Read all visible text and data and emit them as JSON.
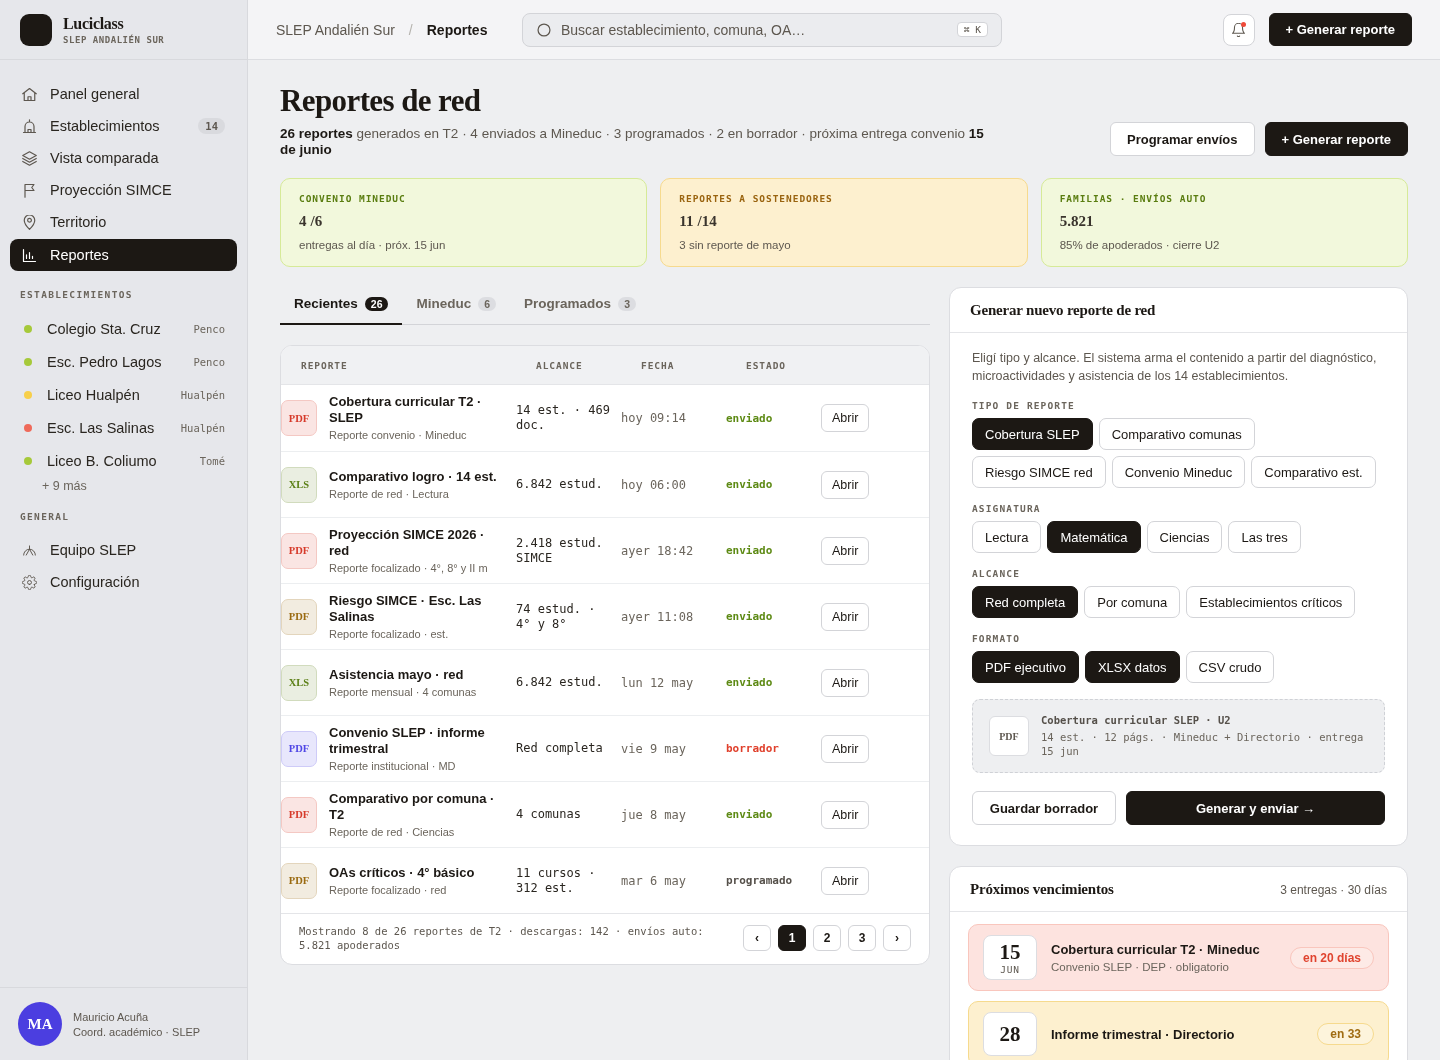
{
  "sidebar": {
    "brand": {
      "name": "Luciclass",
      "subtitle": "SLEP ANDALIÉN SUR"
    },
    "nav": [
      {
        "label": "Panel general",
        "selected": false
      },
      {
        "label": "Establecimientos",
        "badge": "14",
        "selected": false
      },
      {
        "label": "Vista comparada",
        "selected": false
      },
      {
        "label": "Proyección SIMCE",
        "selected": false
      },
      {
        "label": "Territorio",
        "selected": false
      },
      {
        "label": "Reportes",
        "selected": true
      }
    ],
    "schools_heading": "ESTABLECIMIENTOS",
    "schools": [
      {
        "name": "Colegio Sta. Cruz",
        "commune": "Penco",
        "color": "#a6c93a"
      },
      {
        "name": "Esc. Pedro Lagos",
        "commune": "Penco",
        "color": "#a6c93a"
      },
      {
        "name": "Liceo Hualpén",
        "commune": "Hualpén",
        "color": "#f7cf4a"
      },
      {
        "name": "Esc. Las Salinas",
        "commune": "Hualpén",
        "color": "#ef6a5a"
      },
      {
        "name": "Liceo B. Coliumo",
        "commune": "Tomé",
        "color": "#a6c93a"
      }
    ],
    "schools_more": "+ 9 más",
    "general_heading": "GENERAL",
    "general": [
      {
        "label": "Equipo SLEP",
        "selected": false
      },
      {
        "label": "Configuración",
        "selected": false
      }
    ],
    "user": {
      "initials": "MA",
      "name": "Mauricio Acuña",
      "role": "Coord. académico · SLEP"
    }
  },
  "topbar": {
    "breadcrumb": {
      "items": [
        "SLEP Andalién Sur",
        "Reportes"
      ],
      "separator": "/"
    },
    "search": {
      "placeholder": "Buscar establecimiento, comuna, OA…",
      "shortcut": "⌘ K"
    },
    "notifications": {
      "unread": true
    },
    "primary_button": "+ Generar reporte"
  },
  "header": {
    "title": "Reportes de red",
    "summary": "**26 reportes** generados en T2 · 4 enviados a Mineduc · 3 programados · 2 en borrador · próxima entrega convenio **15 de junio**",
    "actions": [
      {
        "label": "Programar envíos",
        "kind": "secondary"
      },
      {
        "label": "+ Generar reporte",
        "kind": "primary"
      }
    ]
  },
  "kpis": [
    {
      "label": "CONVENIO MINEDUC",
      "value": "4",
      "total": "/6",
      "note": "entregas al día · próx. 15 jun",
      "kind": "ok"
    },
    {
      "label": "REPORTES A SOSTENEDORES",
      "value": "11",
      "total": "/14",
      "note": "3 sin reporte de mayo",
      "kind": "warning"
    },
    {
      "label": "FAMILIAS · ENVÍOS AUTO",
      "value": "5.821",
      "note": "85% de apoderados · cierre U2",
      "kind": "ok"
    }
  ],
  "tabs": [
    {
      "label": "Recientes",
      "count": "26",
      "selected": true
    },
    {
      "label": "Mineduc",
      "count": "6",
      "selected": false
    },
    {
      "label": "Programados",
      "count": "3",
      "selected": false
    }
  ],
  "table": {
    "columns": [
      "REPORTE",
      "ALCANCE",
      "FECHA",
      "ESTADO"
    ],
    "rows": [
      {
        "file": {
          "format": "PDF",
          "color": "#d63a2a"
        },
        "title": "Cobertura curricular T2 · SLEP",
        "subtitle": "Reporte convenio · Mineduc",
        "scope": "14 est. · 469 doc.",
        "date": "hoy 09:14",
        "status": {
          "label": "enviado",
          "color": "#5d8a14"
        },
        "action": "Abrir"
      },
      {
        "file": {
          "format": "XLS",
          "color": "#5b7f15"
        },
        "title": "Comparativo logro · 14 est.",
        "subtitle": "Reporte de red · Lectura",
        "scope": "6.842 estud.",
        "date": "hoy 06:00",
        "status": {
          "label": "enviado",
          "color": "#5d8a14"
        },
        "action": "Abrir"
      },
      {
        "file": {
          "format": "PDF",
          "color": "#d63a2a"
        },
        "title": "Proyección SIMCE 2026 · red",
        "subtitle": "Reporte focalizado · 4°, 8° y II m",
        "scope": "2.418 estud. SIMCE",
        "date": "ayer 18:42",
        "status": {
          "label": "enviado",
          "color": "#5d8a14"
        },
        "action": "Abrir"
      },
      {
        "file": {
          "format": "PDF",
          "color": "#9a6a10"
        },
        "title": "Riesgo SIMCE · Esc. Las Salinas",
        "subtitle": "Reporte focalizado · est.",
        "scope": "74 estud. · 4° y 8°",
        "date": "ayer 11:08",
        "status": {
          "label": "enviado",
          "color": "#5d8a14"
        },
        "action": "Abrir"
      },
      {
        "file": {
          "format": "XLS",
          "color": "#5b7f15"
        },
        "title": "Asistencia mayo · red",
        "subtitle": "Reporte mensual · 4 comunas",
        "scope": "6.842 estud.",
        "date": "lun 12 may",
        "status": {
          "label": "enviado",
          "color": "#5d8a14"
        },
        "action": "Abrir"
      },
      {
        "file": {
          "format": "PDF",
          "color": "#4f46e5"
        },
        "title": "Convenio SLEP · informe trimestral",
        "subtitle": "Reporte institucional · MD",
        "scope": "Red completa",
        "date": "vie 9 may",
        "status": {
          "label": "borrador",
          "color": "#e0402c"
        },
        "action": "Abrir"
      },
      {
        "file": {
          "format": "PDF",
          "color": "#d63a2a"
        },
        "title": "Comparativo por comuna · T2",
        "subtitle": "Reporte de red · Ciencias",
        "scope": "4 comunas",
        "date": "jue 8 may",
        "status": {
          "label": "enviado",
          "color": "#5d8a14"
        },
        "action": "Abrir"
      },
      {
        "file": {
          "format": "PDF",
          "color": "#9a6a10"
        },
        "title": "OAs críticos · 4° básico",
        "subtitle": "Reporte focalizado · red",
        "scope": "11 cursos · 312 est.",
        "date": "mar 6 may",
        "status": {
          "label": "programado",
          "color": "#55504a"
        },
        "action": "Abrir"
      }
    ],
    "footer": "Mostrando 8 de 26 reportes de T2 · descargas: 142 · envíos auto: 5.821 apoderados",
    "pagination": {
      "previous": "‹",
      "pages": [
        {
          "label": "1",
          "selected": true
        },
        {
          "label": "2",
          "selected": false
        },
        {
          "label": "3",
          "selected": false
        }
      ],
      "next": "›"
    }
  },
  "generator": {
    "title": "Generar nuevo reporte de red",
    "description": "Eligí tipo y alcance. El sistema arma el contenido a partir del diagnóstico, microactividades y asistencia de los 14 establecimientos.",
    "groups": [
      {
        "label": "TIPO DE REPORTE",
        "options": [
          {
            "label": "Cobertura SLEP",
            "selected": true
          },
          {
            "label": "Comparativo comunas",
            "selected": false
          },
          {
            "label": "Riesgo SIMCE red",
            "selected": false
          },
          {
            "label": "Convenio Mineduc",
            "selected": false
          },
          {
            "label": "Comparativo est.",
            "selected": false
          }
        ]
      },
      {
        "label": "ASIGNATURA",
        "options": [
          {
            "label": "Lectura",
            "selected": false
          },
          {
            "label": "Matemática",
            "selected": true
          },
          {
            "label": "Ciencias",
            "selected": false
          },
          {
            "label": "Las tres",
            "selected": false
          }
        ]
      },
      {
        "label": "ALCANCE",
        "options": [
          {
            "label": "Red completa",
            "selected": true
          },
          {
            "label": "Por comuna",
            "selected": false
          },
          {
            "label": "Establecimientos críticos",
            "selected": false
          }
        ]
      },
      {
        "label": "FORMATO",
        "options": [
          {
            "label": "PDF ejecutivo",
            "selected": true
          },
          {
            "label": "XLSX datos",
            "selected": true
          },
          {
            "label": "CSV crudo",
            "selected": false
          }
        ]
      }
    ],
    "preview": {
      "format": "PDF",
      "title": "Cobertura curricular SLEP · U2",
      "details": "14 est. · 12 págs. · Mineduc + Directorio · entrega 15 jun"
    },
    "actions": [
      {
        "label": "Guardar borrador",
        "kind": "secondary"
      },
      {
        "label": "Generar y enviar →",
        "kind": "primary"
      }
    ]
  },
  "deadlines": {
    "title": "Próximos vencimientos",
    "summary": "3 entregas · 30 días",
    "items": [
      {
        "day": "15",
        "month": "JUN",
        "title": "Cobertura curricular T2 · Mineduc",
        "subtitle": "Convenio SLEP · DEP · obligatorio",
        "due": "en 20 días",
        "kind": "urgent"
      },
      {
        "day": "28",
        "title": "Informe trimestral · Directorio",
        "due": "en 33",
        "kind": "soon"
      }
    ]
  }
}
